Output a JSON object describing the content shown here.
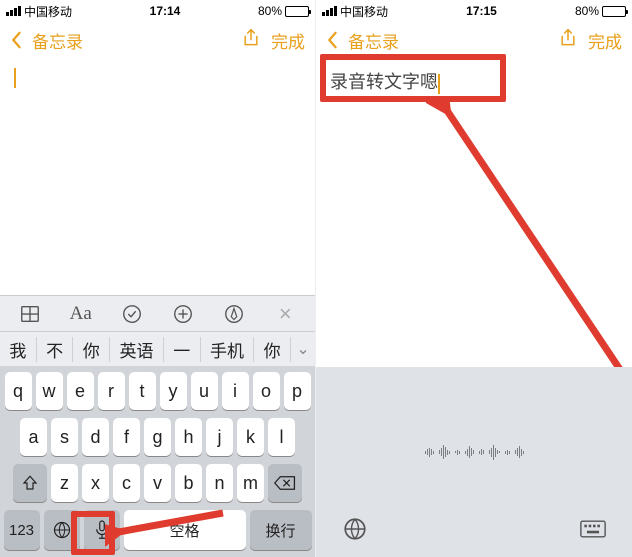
{
  "left": {
    "status": {
      "carrier": "中国移动",
      "time": "17:14",
      "battery": "80%"
    },
    "nav": {
      "back": "备忘录",
      "done": "完成"
    },
    "note_text": "",
    "toolbar": {
      "aa": "Aa"
    },
    "predictions": [
      "我",
      "不",
      "你",
      "英语",
      "一",
      "手机",
      "你"
    ],
    "keys_row1": [
      "q",
      "w",
      "e",
      "r",
      "t",
      "y",
      "u",
      "i",
      "o",
      "p"
    ],
    "keys_row2": [
      "a",
      "s",
      "d",
      "f",
      "g",
      "h",
      "j",
      "k",
      "l"
    ],
    "keys_row3": [
      "z",
      "x",
      "c",
      "v",
      "b",
      "n",
      "m"
    ],
    "bottom": {
      "num": "123",
      "space": "空格",
      "return": "换行"
    }
  },
  "right": {
    "status": {
      "carrier": "中国移动",
      "time": "17:15",
      "battery": "80%"
    },
    "nav": {
      "back": "备忘录",
      "done": "完成"
    },
    "note_text": "录音转文字嗯"
  }
}
